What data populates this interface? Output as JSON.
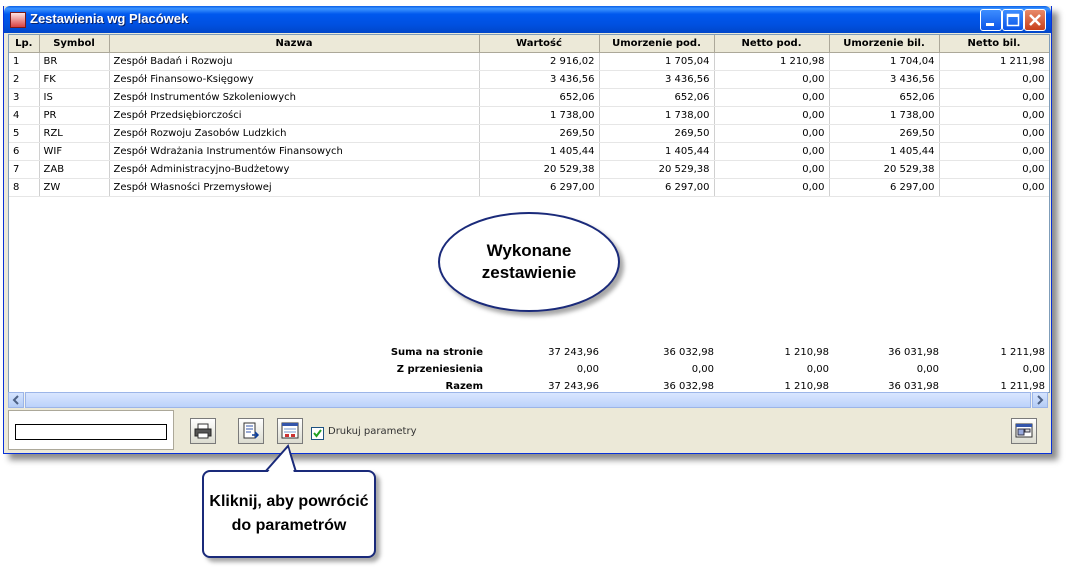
{
  "window": {
    "title": "Zestawienia wg Placówek"
  },
  "table": {
    "headers": [
      "Lp.",
      "Symbol",
      "Nazwa",
      "Wartość",
      "Umorzenie pod.",
      "Netto pod.",
      "Umorzenie bil.",
      "Netto bil."
    ],
    "rows": [
      [
        "1",
        "BR",
        "Zespół Badań i Rozwoju",
        "2 916,02",
        "1 705,04",
        "1 210,98",
        "1 704,04",
        "1 211,98"
      ],
      [
        "2",
        "FK",
        "Zespół Finansowo-Księgowy",
        "3 436,56",
        "3 436,56",
        "0,00",
        "3 436,56",
        "0,00"
      ],
      [
        "3",
        "IS",
        "Zespół Instrumentów Szkoleniowych",
        "652,06",
        "652,06",
        "0,00",
        "652,06",
        "0,00"
      ],
      [
        "4",
        "PR",
        "Zespół Przedsiębiorczości",
        "1 738,00",
        "1 738,00",
        "0,00",
        "1 738,00",
        "0,00"
      ],
      [
        "5",
        "RZL",
        "Zespół Rozwoju Zasobów Ludzkich",
        "269,50",
        "269,50",
        "0,00",
        "269,50",
        "0,00"
      ],
      [
        "6",
        "WIF",
        "Zespół Wdrażania Instrumentów Finansowych",
        "1 405,44",
        "1 405,44",
        "0,00",
        "1 405,44",
        "0,00"
      ],
      [
        "7",
        "ZAB",
        "Zespół Administracyjno-Budżetowy",
        "20 529,38",
        "20 529,38",
        "0,00",
        "20 529,38",
        "0,00"
      ],
      [
        "8",
        "ZW",
        "Zespół Własności Przemysłowej",
        "6 297,00",
        "6 297,00",
        "0,00",
        "6 297,00",
        "0,00"
      ]
    ]
  },
  "totals": [
    {
      "label": "Suma na stronie",
      "values": [
        "37 243,96",
        "36 032,98",
        "1 210,98",
        "36 031,98",
        "1 211,98"
      ]
    },
    {
      "label": "Z przeniesienia",
      "values": [
        "0,00",
        "0,00",
        "0,00",
        "0,00",
        "0,00"
      ]
    },
    {
      "label": "Razem",
      "values": [
        "37 243,96",
        "36 032,98",
        "1 210,98",
        "36 031,98",
        "1 211,98"
      ]
    }
  ],
  "toolbar": {
    "print_params_label": "Drukuj parametry",
    "print_params_checked": true
  },
  "callouts": {
    "report_line1": "Wykonane",
    "report_line2": "zestawienie",
    "back_line1": "Kliknij, aby powrócić",
    "back_line2": "do parametrów"
  }
}
